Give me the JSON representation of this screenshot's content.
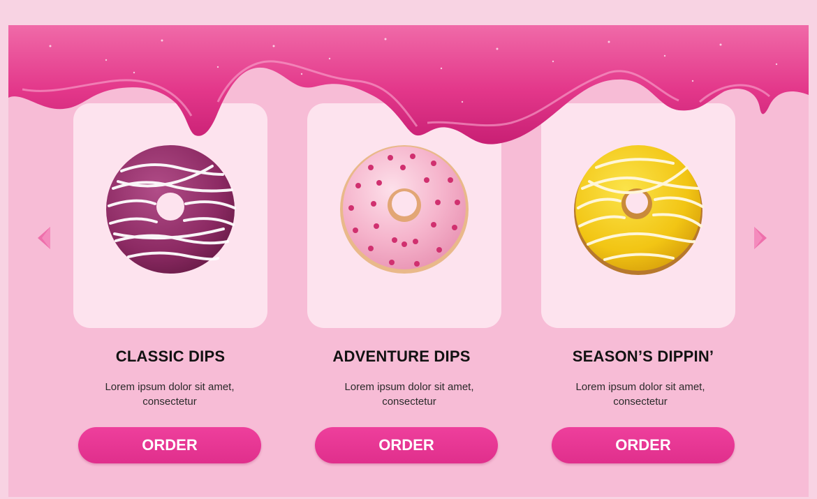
{
  "colors": {
    "page_background": "#f8d3e3",
    "panel_background": "#f7bcd6",
    "card_background": "#fde3ee",
    "icing": "#e8338a",
    "button": "#e8398f",
    "arrow": "#ee6fab"
  },
  "carousel": {
    "prev_icon": "triangle-left-icon",
    "next_icon": "triangle-right-icon"
  },
  "products": [
    {
      "title": "CLASSIC DIPS",
      "desc_line1": "Lorem ipsum dolor sit amet,",
      "desc_line2": "consectetur",
      "button": "ORDER",
      "donut_icon": "purple-drizzle-donut"
    },
    {
      "title": "ADVENTURE DIPS",
      "desc_line1": "Lorem ipsum dolor sit amet,",
      "desc_line2": "consectetur",
      "button": "ORDER",
      "donut_icon": "pink-sprinkle-donut"
    },
    {
      "title": "SEASON’S DIPPIN’",
      "desc_line1": "Lorem ipsum dolor sit amet,",
      "desc_line2": "consectetur",
      "button": "ORDER",
      "donut_icon": "yellow-drizzle-donut"
    }
  ]
}
